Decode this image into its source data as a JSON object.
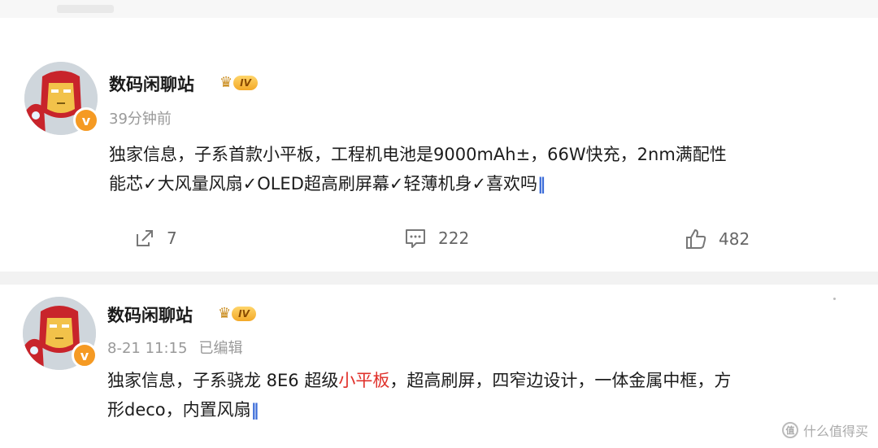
{
  "posts": [
    {
      "username": "数码闲聊站",
      "level": "IV",
      "timestamp": "39分钟前",
      "edited_label": "",
      "content_line1": "独家信息，子系首款小平板，工程机电池是9000mAh±，66W快充，2nm满配性",
      "content_line2": "能芯✓大风量风扇✓OLED超高刷屏幕✓轻薄机身✓喜欢吗",
      "emoji": "🙏",
      "stats": {
        "reposts": "7",
        "comments": "222",
        "likes": "482"
      }
    },
    {
      "username": "数码闲聊站",
      "level": "IV",
      "timestamp": "8-21 11:15",
      "edited_label": "已编辑",
      "content_part1": "独家信息，子系骁龙 8E6 超级",
      "content_highlight": "小平板",
      "content_part2": "，超高刷屏，四窄边设计，一体金属中框，方",
      "content_line2": "形deco，内置风扇",
      "emoji": "🙏"
    }
  ],
  "watermark": "什么值得买",
  "colors": {
    "highlight": "#e0302a",
    "level_badge": "#f3a928",
    "verified": "#f59a23"
  }
}
